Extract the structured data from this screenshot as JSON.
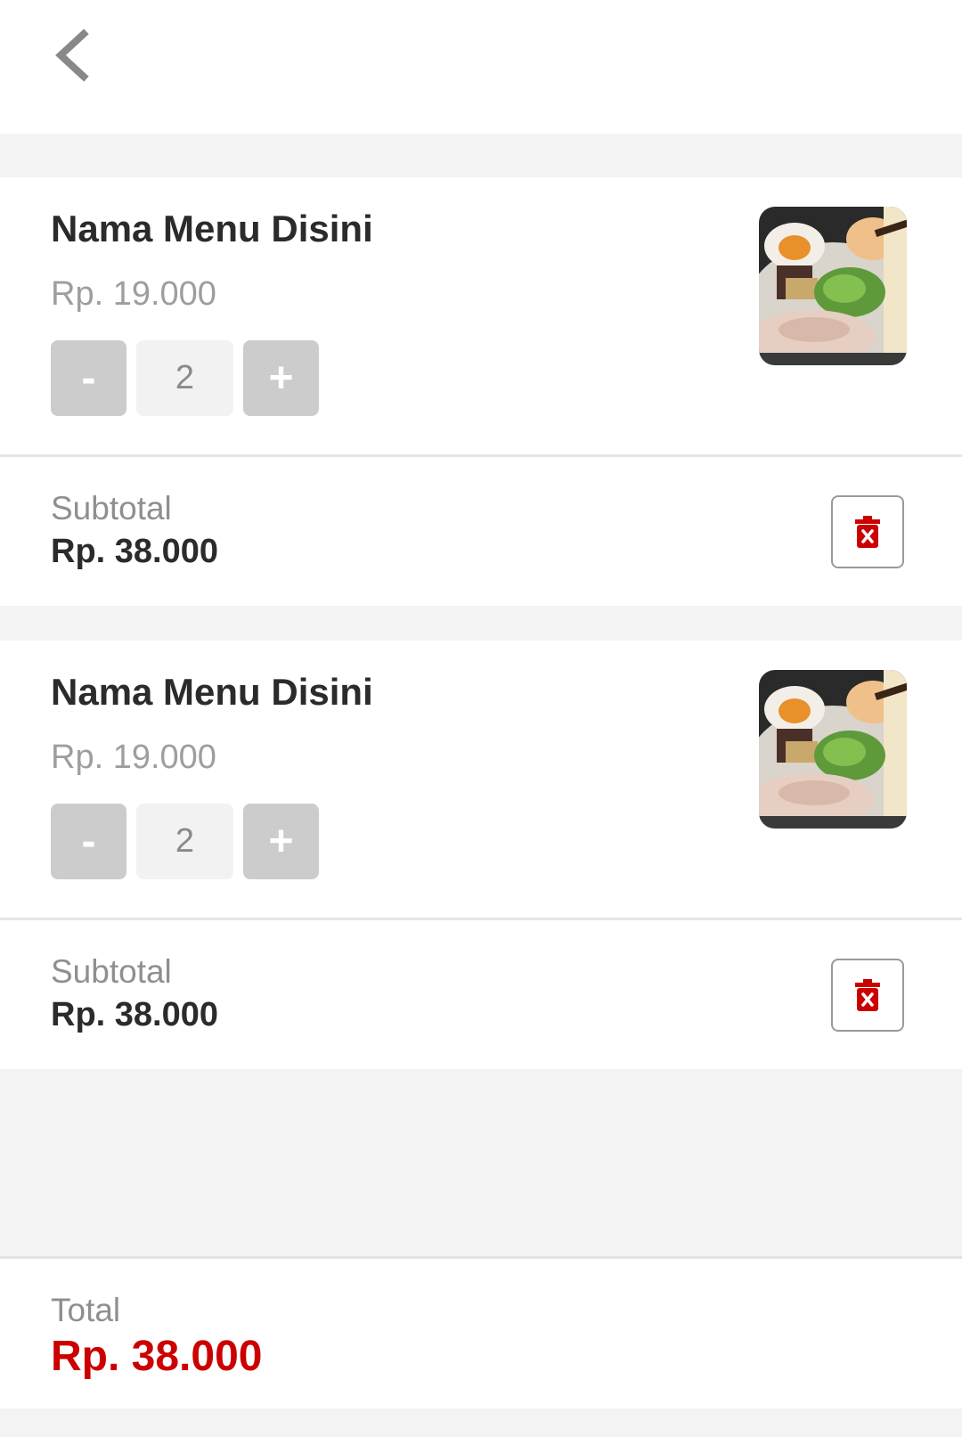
{
  "header": {
    "back_icon": "chevron-left-icon"
  },
  "cart": {
    "items": [
      {
        "name": "Nama Menu Disini",
        "price": "Rp. 19.000",
        "minus_label": "-",
        "quantity": "2",
        "plus_label": "+",
        "subtotal_label": "Subtotal",
        "subtotal_value": "Rp. 38.000",
        "delete_icon": "trash-icon"
      },
      {
        "name": "Nama Menu Disini",
        "price": "Rp. 19.000",
        "minus_label": "-",
        "quantity": "2",
        "plus_label": "+",
        "subtotal_label": "Subtotal",
        "subtotal_value": "Rp. 38.000",
        "delete_icon": "trash-icon"
      }
    ]
  },
  "total": {
    "label": "Total",
    "value": "Rp. 38.000"
  },
  "colors": {
    "accent": "#cc0000",
    "stepper_button": "#cccccc",
    "background": "#f3f3f3"
  }
}
